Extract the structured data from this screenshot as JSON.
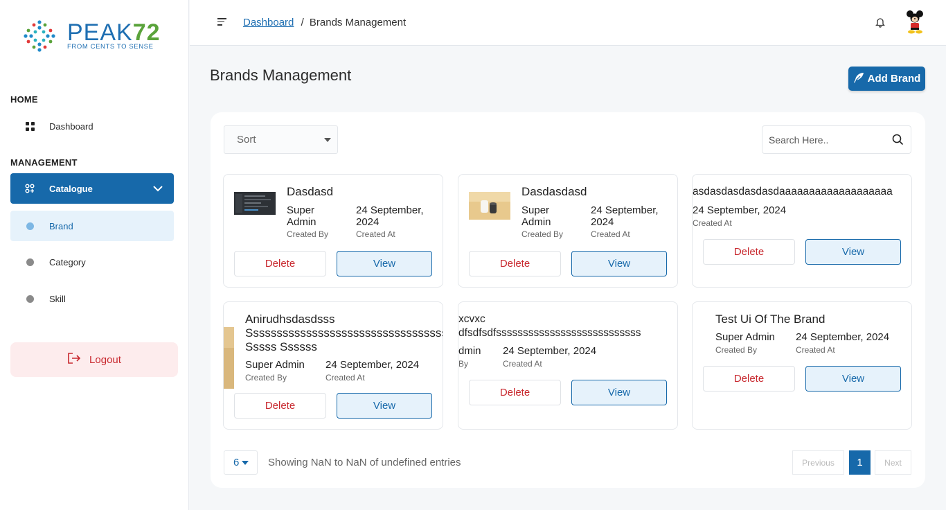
{
  "logo": {
    "title": "PEAK",
    "title_num": "72",
    "tagline": "FROM CENTS TO SENSE"
  },
  "sidebar": {
    "home_label": "HOME",
    "dashboard": "Dashboard",
    "management_label": "MANAGEMENT",
    "catalogue": "Catalogue",
    "sub_items": [
      "Brand",
      "Category",
      "Skill"
    ],
    "logout": "Logout"
  },
  "topbar": {
    "breadcrumb_link": "Dashboard",
    "breadcrumb_sep": "/",
    "breadcrumb_current": "Brands Management"
  },
  "page": {
    "title": "Brands Management",
    "add_button": "Add Brand"
  },
  "filters": {
    "sort_label": "Sort",
    "search_placeholder": "Search Here.."
  },
  "labels": {
    "created_by": "Created By",
    "created_at": "Created At",
    "delete": "Delete",
    "view": "View"
  },
  "brands": [
    {
      "name": "Dasdasd",
      "created_by": "Super Admin",
      "created_at": "24 September, 2024"
    },
    {
      "name": "Dasdasdasd",
      "created_by": "Super Admin",
      "created_at": "24 September, 2024"
    },
    {
      "name": "asdasdasdasdasdaaaaaaaaaaaaaaaaaaa",
      "created_at": "24 September, 2024"
    },
    {
      "name": "Anirudhsdasdsss Sssssssssssssssssssssssssssssssssss Sssss Ssssss",
      "name_line1": "Anirudhsdasdsss",
      "name_line2": "Sssssssssssssssssssssssssssssssssss",
      "name_line3": "Sssss Ssssss",
      "created_by": "Super Admin",
      "created_at": "24 September, 2024"
    },
    {
      "name_line1": "xcvxc",
      "name_line2": "dfsdfsdfsssssssssssssssssssssssssss",
      "created_by": "dmin",
      "created_by_label": "By",
      "created_at": "24 September, 2024"
    },
    {
      "name": "Test Ui Of The Brand",
      "created_by": "Super Admin",
      "created_at": "24 September, 2024"
    }
  ],
  "pagination": {
    "page_size": "6",
    "showing": "Showing NaN to NaN of undefined entries",
    "previous": "Previous",
    "current": "1",
    "next": "Next"
  },
  "colors": {
    "primary": "#1769aa",
    "danger": "#c8282e",
    "active_bg": "#e6f2fb",
    "logout_bg": "#fdeced"
  },
  "icons": [
    "peak72-logo",
    "grid-icon",
    "catalogue-icon",
    "chevron-down-icon",
    "logout-icon",
    "menu-icon",
    "bell-icon",
    "avatar-icon",
    "feather-icon",
    "caret-down-icon",
    "search-icon"
  ]
}
